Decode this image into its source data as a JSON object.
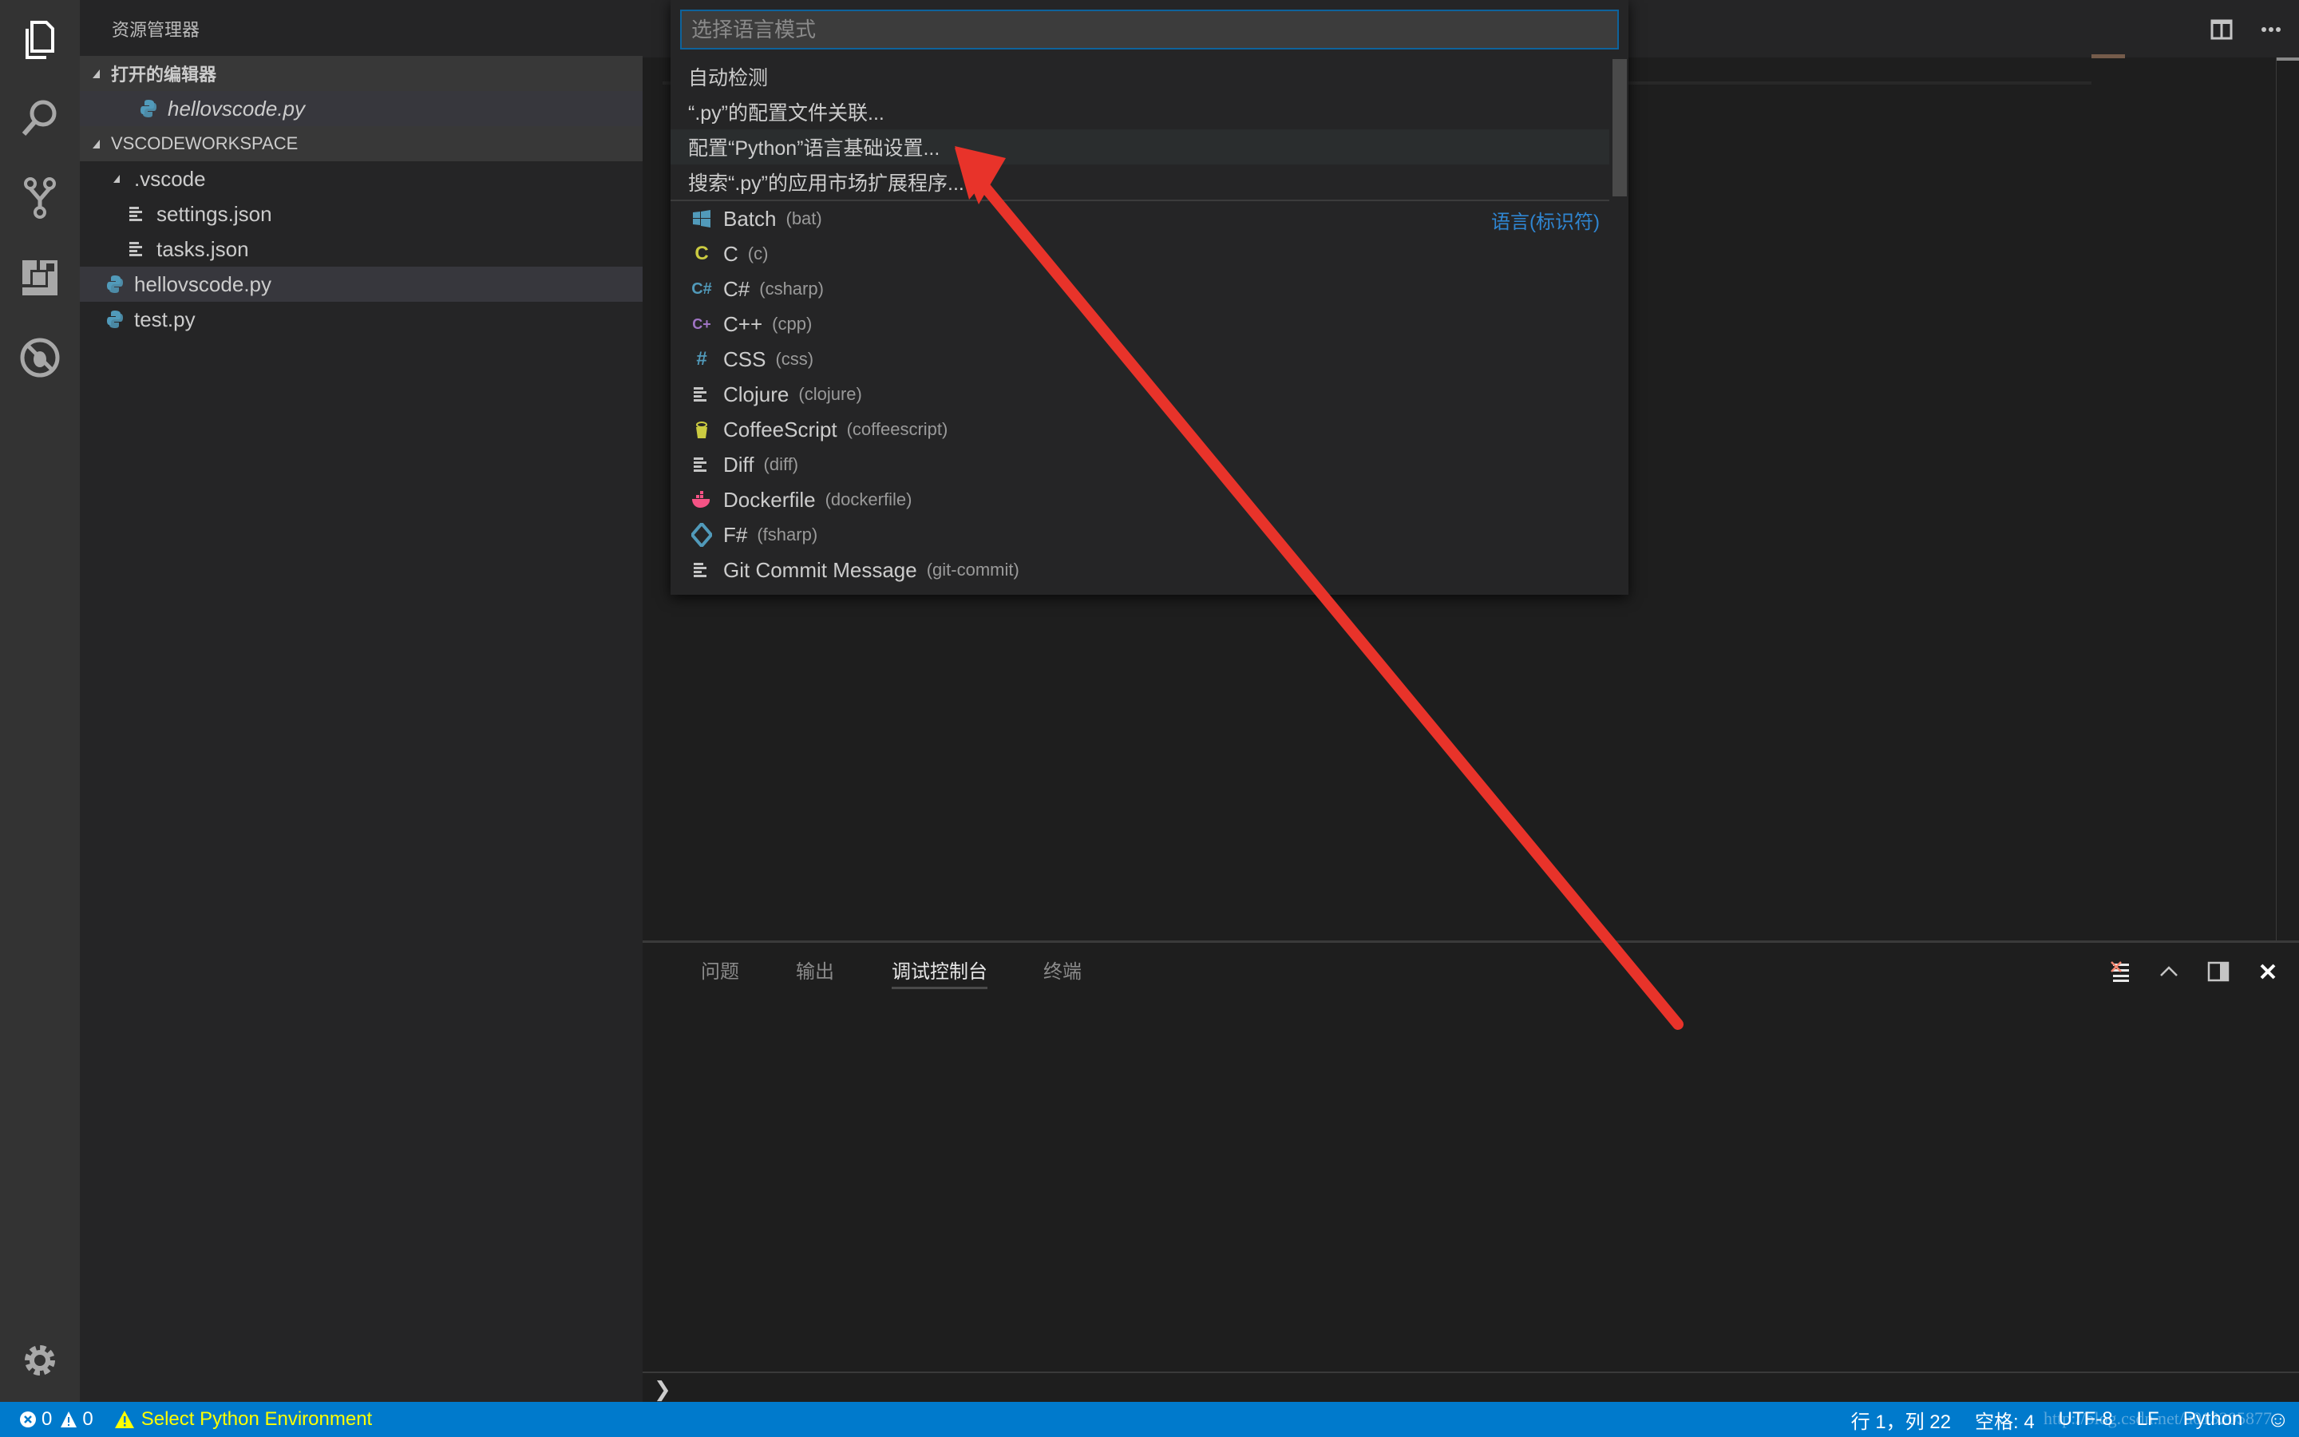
{
  "sidebar": {
    "title": "资源管理器",
    "open_editors_header": "打开的编辑器",
    "open_editors": [
      {
        "name": "hellovscode.py",
        "icon": "python-icon"
      }
    ],
    "workspace_header": "VSCODEWORKSPACE",
    "tree": [
      {
        "name": ".vscode",
        "type": "folder",
        "expanded": true
      },
      {
        "name": "settings.json",
        "type": "file",
        "icon": "lines-icon"
      },
      {
        "name": "tasks.json",
        "type": "file",
        "icon": "lines-icon"
      },
      {
        "name": "hellovscode.py",
        "type": "file",
        "icon": "python-icon",
        "selected": true
      },
      {
        "name": "test.py",
        "type": "file",
        "icon": "python-icon"
      }
    ]
  },
  "activity_bar": [
    "explorer-icon",
    "search-icon",
    "source-control-icon",
    "extensions-icon",
    "debug-icon",
    "settings-gear-icon"
  ],
  "quick_pick": {
    "placeholder": "选择语言模式",
    "value": "",
    "actions": [
      "自动检测",
      "“.py”的配置文件关联...",
      "配置“Python”语言基础设置...",
      "搜索“.py”的应用市场扩展程序..."
    ],
    "group_label": "语言(标识符)",
    "languages": [
      {
        "name": "Batch",
        "id": "(bat)",
        "icon": "windows-icon",
        "color": "#519aba"
      },
      {
        "name": "C",
        "id": "(c)",
        "icon": "c-icon",
        "color": "#cbcb41"
      },
      {
        "name": "C#",
        "id": "(csharp)",
        "icon": "csharp-icon",
        "color": "#519aba"
      },
      {
        "name": "C++",
        "id": "(cpp)",
        "icon": "cpp-icon",
        "color": "#a074c4"
      },
      {
        "name": "CSS",
        "id": "(css)",
        "icon": "hash-icon",
        "color": "#519aba"
      },
      {
        "name": "Clojure",
        "id": "(clojure)",
        "icon": "lines-icon",
        "color": "#c5c5c5"
      },
      {
        "name": "CoffeeScript",
        "id": "(coffeescript)",
        "icon": "coffee-icon",
        "color": "#cbcb41"
      },
      {
        "name": "Diff",
        "id": "(diff)",
        "icon": "lines-icon",
        "color": "#c5c5c5"
      },
      {
        "name": "Dockerfile",
        "id": "(dockerfile)",
        "icon": "docker-icon",
        "color": "#f55385"
      },
      {
        "name": "F#",
        "id": "(fsharp)",
        "icon": "fsharp-icon",
        "color": "#519aba"
      },
      {
        "name": "Git Commit Message",
        "id": "(git-commit)",
        "icon": "lines-icon",
        "color": "#c5c5c5"
      }
    ]
  },
  "panel": {
    "tabs": [
      "问题",
      "输出",
      "调试控制台",
      "终端"
    ],
    "active_tab": "调试控制台",
    "prompt": "❯"
  },
  "statusbar": {
    "errors": "0",
    "warnings": "0",
    "python_env": "Select Python Environment",
    "position": "行 1，列 22",
    "spaces": "空格: 4",
    "encoding": "UTF-8",
    "eol": "LF",
    "language": "Python",
    "watermark": "http://blog.csdn.net/u013205877"
  },
  "colors": {
    "accent": "#007acc",
    "warning_text": "#ffff00",
    "annotation_arrow": "#e8332a"
  }
}
